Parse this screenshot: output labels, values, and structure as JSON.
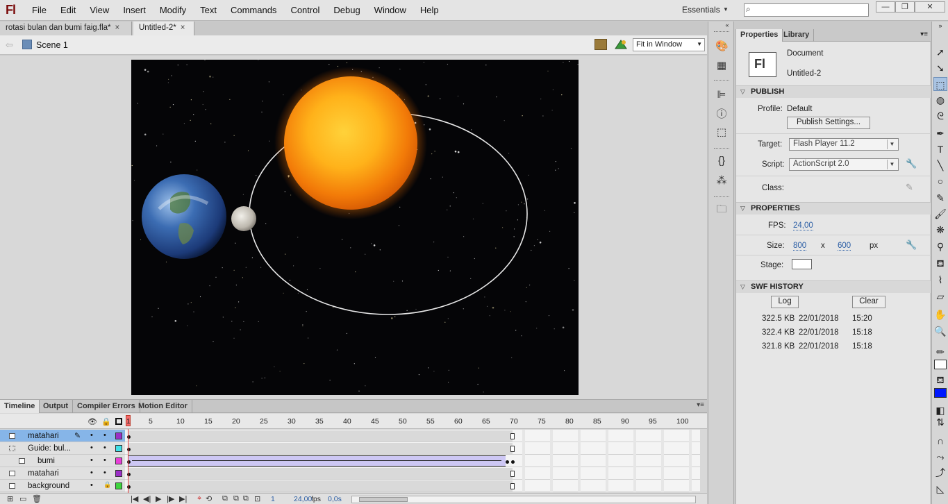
{
  "app": {
    "logo": "Fl",
    "menus": [
      "File",
      "Edit",
      "View",
      "Insert",
      "Modify",
      "Text",
      "Commands",
      "Control",
      "Debug",
      "Window",
      "Help"
    ],
    "workspace": "Essentials",
    "search_placeholder": "",
    "window_buttons": {
      "minimize": "—",
      "restore": "❐",
      "close": "✕"
    }
  },
  "doc_tabs": [
    {
      "label": "rotasi bulan dan bumi faig.fla*",
      "close": "×"
    },
    {
      "label": "Untitled-2*",
      "close": "×"
    }
  ],
  "editbar": {
    "scene": "Scene 1",
    "zoom": "Fit in Window"
  },
  "timeline": {
    "tabs": [
      "Timeline",
      "Output",
      "Compiler Errors",
      "Motion Editor"
    ],
    "frame_numbers": [
      "1",
      "5",
      "10",
      "15",
      "20",
      "25",
      "30",
      "35",
      "40",
      "45",
      "50",
      "55",
      "60",
      "65",
      "70",
      "75",
      "80",
      "85",
      "90",
      "95",
      "100"
    ],
    "layers": [
      {
        "name": "matahari",
        "selected": true,
        "color": "#9b2fc7"
      },
      {
        "name": "Guide: bul...",
        "selected": false,
        "color": "#3fe0e8"
      },
      {
        "name": "bumi",
        "selected": false,
        "color": "#e83fd8"
      },
      {
        "name": "matahari",
        "selected": false,
        "color": "#9b2fc7"
      },
      {
        "name": "background",
        "selected": false,
        "color": "#3ed43e"
      }
    ],
    "current_frame": "1",
    "fps": "24,00",
    "fps_unit": "fps",
    "time": "0,0s"
  },
  "properties": {
    "tabs": [
      "Properties",
      "Library"
    ],
    "doc_type": "Document",
    "doc_name": "Untitled-2",
    "doc_icon": "Fl",
    "publish": {
      "header": "PUBLISH",
      "profile_label": "Profile:",
      "profile_value": "Default",
      "settings_button": "Publish Settings...",
      "target_label": "Target:",
      "target_value": "Flash Player 11.2",
      "script_label": "Script:",
      "script_value": "ActionScript 2.0",
      "class_label": "Class:"
    },
    "props": {
      "header": "PROPERTIES",
      "fps_label": "FPS:",
      "fps_value": "24,00",
      "size_label": "Size:",
      "width": "800",
      "x": "x",
      "height": "600",
      "unit": "px",
      "stage_label": "Stage:",
      "stage_color": "#ffffff"
    },
    "swf_history": {
      "header": "SWF HISTORY",
      "log_button": "Log",
      "clear_button": "Clear",
      "entries": [
        {
          "size": "322.5 KB",
          "date": "22/01/2018",
          "time": "15:20"
        },
        {
          "size": "322.4 KB",
          "date": "22/01/2018",
          "time": "15:18"
        },
        {
          "size": "321.8 KB",
          "date": "22/01/2018",
          "time": "15:18"
        }
      ]
    }
  },
  "colors": {
    "selected_layer": "#86b5e8",
    "fill_color": "#0018ff",
    "stroke_color": "#ffffff",
    "playhead": "#e23a3a"
  }
}
